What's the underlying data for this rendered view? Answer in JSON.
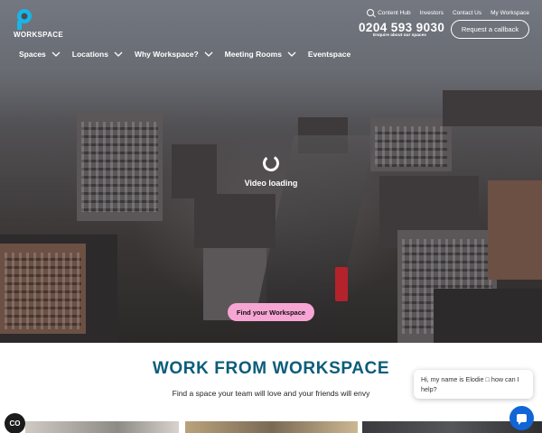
{
  "brand": {
    "logo_text": "WORKSPACE"
  },
  "toplinks": [
    "Content Hub",
    "Investors",
    "Contact Us",
    "My Workspace"
  ],
  "contact": {
    "phone": "0204 593 9030",
    "phone_sub": "Enquire about our spaces",
    "callback_label": "Request a callback"
  },
  "nav": [
    {
      "label": "Spaces",
      "dropdown": true
    },
    {
      "label": "Locations",
      "dropdown": true
    },
    {
      "label": "Why Workspace?",
      "dropdown": true
    },
    {
      "label": "Meeting Rooms",
      "dropdown": true
    },
    {
      "label": "Eventspace",
      "dropdown": false
    }
  ],
  "hero": {
    "loading_text": "Video loading",
    "cta_label": "Find your Workspace"
  },
  "section": {
    "heading": "WORK FROM WORKSPACE",
    "tagline": "Find a space your team will love and your friends will envy"
  },
  "cookie": {
    "label": "CO"
  },
  "chat": {
    "message": "Hi, my name is Elodie □ how can I help?"
  },
  "colors": {
    "accent_pink": "#f7a5d4",
    "heading_teal": "#0b5d7a",
    "chat_blue": "#1265d6",
    "logo_cyan": "#19b5e6"
  },
  "icons": [
    "search-icon",
    "chevron-down-icon",
    "loading-spinner-icon",
    "chat-icon"
  ]
}
